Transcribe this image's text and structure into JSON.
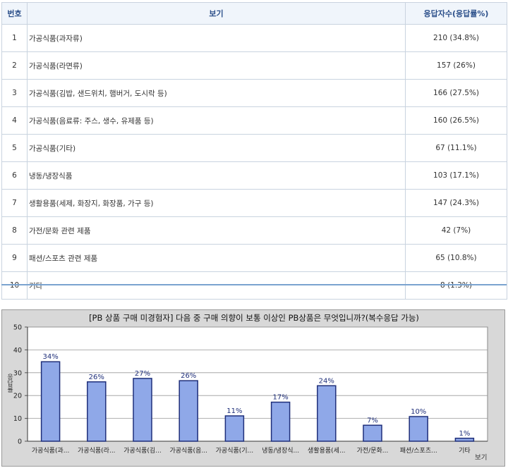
{
  "table": {
    "headers": {
      "num": "번호",
      "item": "보기",
      "count": "응답자수(응답률%)"
    },
    "rows": [
      {
        "num": "1",
        "label": "가공식품(과자류)",
        "count": "210 (34.8%)"
      },
      {
        "num": "2",
        "label": "가공식품(라면류)",
        "count": "157 (26%)"
      },
      {
        "num": "3",
        "label": "가공식품(김밥, 샌드위치, 햄버거, 도시락 등)",
        "count": "166 (27.5%)"
      },
      {
        "num": "4",
        "label": "가공식품(음료류: 주스, 생수, 유제품 등)",
        "count": "160 (26.5%)"
      },
      {
        "num": "5",
        "label": "가공식품(기타)",
        "count": "67 (11.1%)"
      },
      {
        "num": "6",
        "label": "냉동/냉장식품",
        "count": "103 (17.1%)"
      },
      {
        "num": "7",
        "label": "생활용품(세제, 화장지, 화장품, 가구 등)",
        "count": "147 (24.3%)"
      },
      {
        "num": "8",
        "label": "가전/문화 관련 제품",
        "count": "42 (7%)"
      },
      {
        "num": "9",
        "label": "패션/스포츠 관련 제품",
        "count": "65 (10.8%)"
      },
      {
        "num": "10",
        "label": "기타",
        "count": "8 (1.3%)"
      }
    ]
  },
  "chart_data": {
    "type": "bar",
    "title": "[PB 상품 구매 미경험자] 다음 중 구매 의향이 보통 이상인 PB상품은 무엇입니까?(복수응답 가능)",
    "xlabel": "보기",
    "ylabel": "응답률",
    "ylim": [
      0,
      50
    ],
    "yticks": [
      "0",
      "10",
      "20",
      "30",
      "40",
      "50"
    ],
    "grid": true,
    "categories": [
      "가공식품(과...",
      "가공식품(라...",
      "가공식품(김...",
      "가공식품(음...",
      "가공식품(기...",
      "냉동/냉장식...",
      "생활용품(세...",
      "가전/문화...",
      "패션/스포츠...",
      "기타"
    ],
    "values": [
      34.8,
      26,
      27.5,
      26.5,
      11.1,
      17.1,
      24.3,
      7,
      10.8,
      1.3
    ],
    "data_labels": [
      "34%",
      "26%",
      "27%",
      "26%",
      "11%",
      "17%",
      "24%",
      "7%",
      "10%",
      "1%"
    ],
    "colors": {
      "bar_fill": "#8fa8e8",
      "bar_stroke": "#1f2f7a",
      "label": "#1f2f7a",
      "plot_bg": "#ffffff",
      "frame_bg": "#d8d8d8"
    }
  }
}
